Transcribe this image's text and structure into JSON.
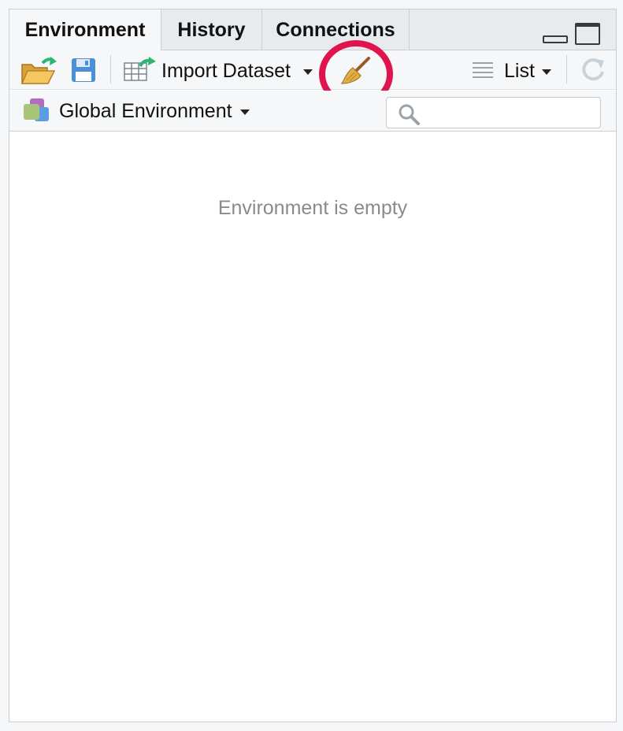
{
  "tabs": [
    {
      "label": "Environment",
      "active": true
    },
    {
      "label": "History",
      "active": false
    },
    {
      "label": "Connections",
      "active": false
    }
  ],
  "toolbar": {
    "open_icon": "open-folder-icon",
    "save_icon": "save-disk-icon",
    "import_label": "Import Dataset",
    "clear_icon": "broom-icon",
    "view_label": "List",
    "refresh_icon": "refresh-icon"
  },
  "environment_bar": {
    "env_label": "Global Environment",
    "search_placeholder": ""
  },
  "main": {
    "empty_message": "Environment is empty"
  },
  "colors": {
    "highlight": "#e0134d",
    "accent_green": "#2bb673",
    "accent_blue": "#4a90d9"
  }
}
